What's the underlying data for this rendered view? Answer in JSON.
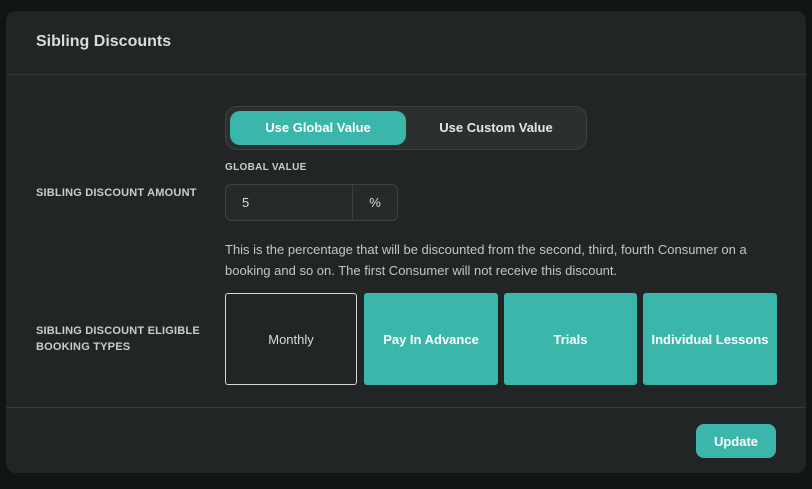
{
  "card": {
    "title": "Sibling Discounts"
  },
  "discount_amount": {
    "label": "SIBLING DISCOUNT AMOUNT",
    "toggle": {
      "options": [
        "Use Global Value",
        "Use Custom Value"
      ],
      "selected": "Use Global Value"
    },
    "field_caption": "GLOBAL VALUE",
    "value": "5",
    "unit": "%",
    "help_text": "This is the percentage that will be discounted from the second, third, fourth Consumer on a booking and so on. The first Consumer will not receive this discount."
  },
  "eligible_types": {
    "label_line1": "SIBLING DISCOUNT ELIGIBLE",
    "label_line2": "BOOKING TYPES",
    "options": [
      {
        "label": "Monthly",
        "selected": false
      },
      {
        "label": "Pay In Advance",
        "selected": true
      },
      {
        "label": "Trials",
        "selected": true
      },
      {
        "label": "Individual Lessons",
        "selected": true
      }
    ]
  },
  "footer": {
    "update_label": "Update"
  },
  "colors": {
    "accent": "#3bb6ab",
    "card_background": "#212525",
    "page_background": "#101414"
  }
}
